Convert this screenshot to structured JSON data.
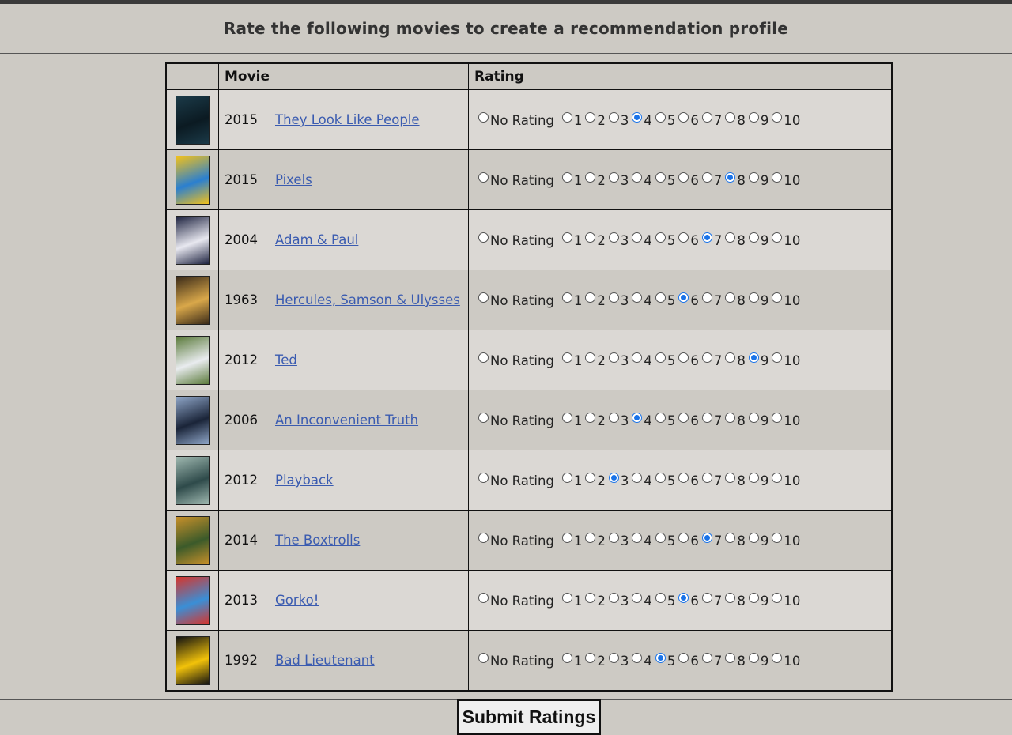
{
  "header": {
    "title": "Rate the following movies to create a recommendation profile"
  },
  "table": {
    "headers": {
      "poster": "",
      "movie": "Movie",
      "rating": "Rating"
    },
    "rating_options": [
      "No Rating",
      "1",
      "2",
      "3",
      "4",
      "5",
      "6",
      "7",
      "8",
      "9",
      "10"
    ],
    "rows": [
      {
        "year": "2015",
        "title": "They Look Like People",
        "rating": "4",
        "poster_colors": [
          "#0b1a22",
          "#1b3a48"
        ]
      },
      {
        "year": "2015",
        "title": "Pixels",
        "rating": "8",
        "poster_colors": [
          "#2a7fd0",
          "#f2c11a"
        ]
      },
      {
        "year": "2004",
        "title": "Adam & Paul",
        "rating": "7",
        "poster_colors": [
          "#e8e8f0",
          "#1e2340"
        ]
      },
      {
        "year": "1963",
        "title": "Hercules, Samson & Ulysses",
        "rating": "6",
        "poster_colors": [
          "#d9a84a",
          "#3a2a18"
        ]
      },
      {
        "year": "2012",
        "title": "Ted",
        "rating": "9",
        "poster_colors": [
          "#e9ecef",
          "#5a7a3a"
        ]
      },
      {
        "year": "2006",
        "title": "An Inconvenient Truth",
        "rating": "4",
        "poster_colors": [
          "#1a2438",
          "#8fa6c8"
        ]
      },
      {
        "year": "2012",
        "title": "Playback",
        "rating": "3",
        "poster_colors": [
          "#2e4a4a",
          "#9fb8b0"
        ]
      },
      {
        "year": "2014",
        "title": "The Boxtrolls",
        "rating": "7",
        "poster_colors": [
          "#3b5a2a",
          "#c8902a"
        ]
      },
      {
        "year": "2013",
        "title": "Gorko!",
        "rating": "6",
        "poster_colors": [
          "#3a8fd6",
          "#d8342a"
        ]
      },
      {
        "year": "1992",
        "title": "Bad Lieutenant",
        "rating": "5",
        "poster_colors": [
          "#f2c20a",
          "#111111"
        ]
      }
    ]
  },
  "submit": {
    "label": "Submit Ratings"
  },
  "colors": {
    "background": "#cdcac4",
    "row_alt": "#dbd8d4",
    "link": "#3a5bb0",
    "radio_checked": "#1a73e8"
  }
}
